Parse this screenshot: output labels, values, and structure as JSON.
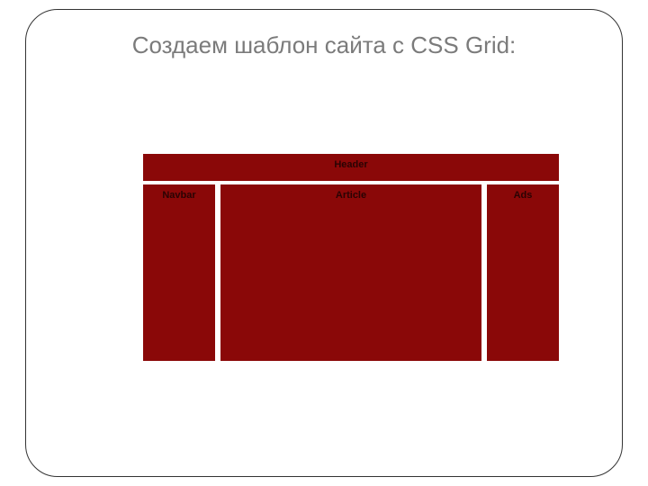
{
  "title": "Создаем шаблон сайта с CSS Grid:",
  "grid": {
    "header": "Header",
    "navbar": "Navbar",
    "article": "Article",
    "ads": "Ads"
  }
}
